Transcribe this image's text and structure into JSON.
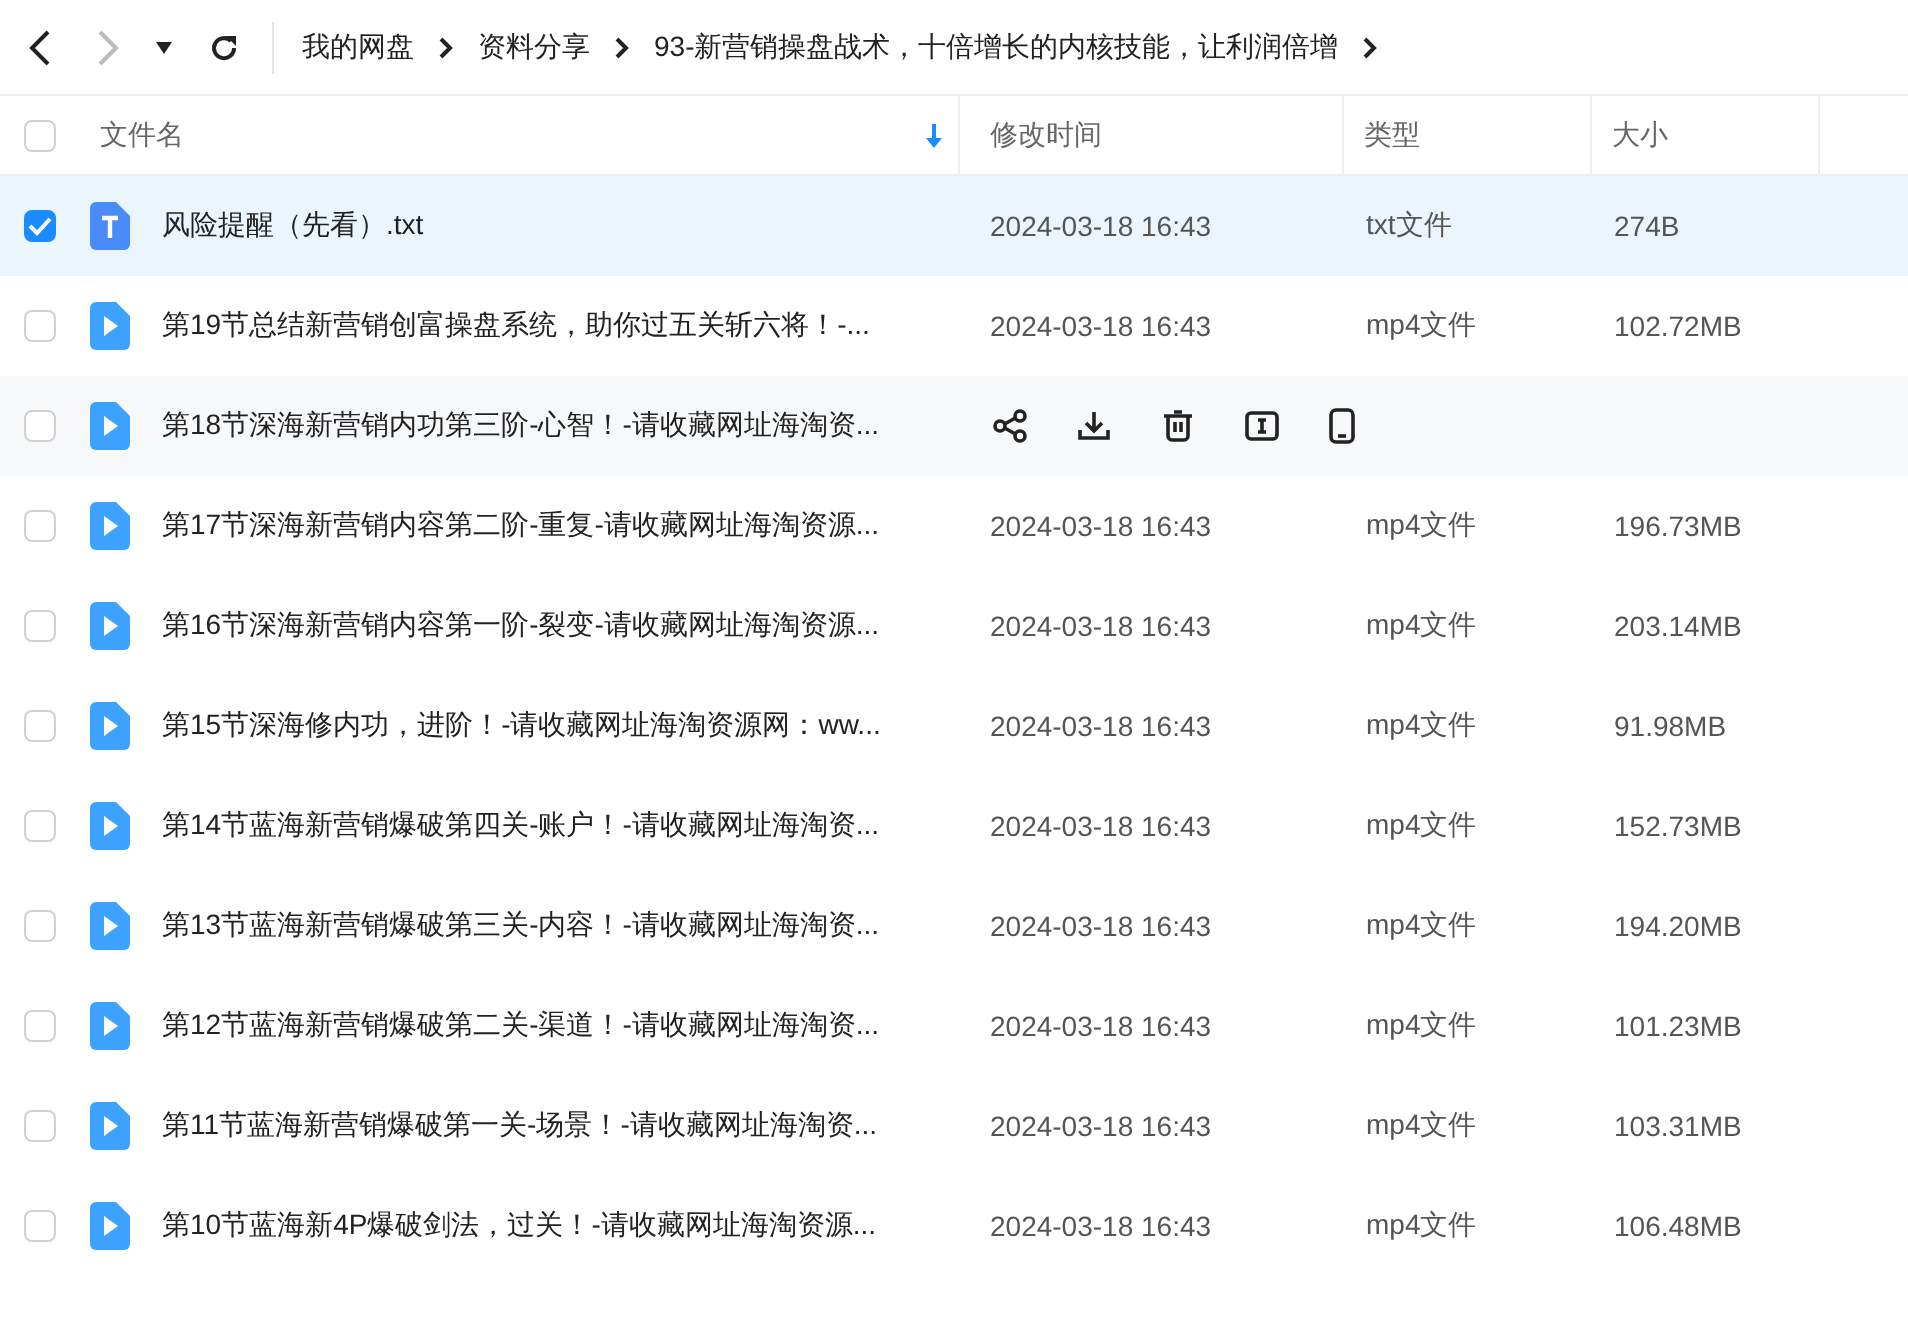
{
  "toolbar": {
    "back_disabled": false,
    "forward_disabled": true
  },
  "breadcrumb": [
    "我的网盘",
    "资料分享",
    "93-新营销操盘战术，十倍增长的内核技能，让利润倍增"
  ],
  "table": {
    "all_checked": false,
    "columns": [
      {
        "label": "文件名",
        "sorted": true
      },
      {
        "label": "修改时间",
        "sorted": false
      },
      {
        "label": "类型",
        "sorted": false
      },
      {
        "label": "大小",
        "sorted": false
      }
    ],
    "rows": [
      {
        "kind": "text",
        "name": "风险提醒（先看）.txt",
        "selected": true,
        "hovered": false,
        "date": "2024-03-18 16:43",
        "type": "txt文件",
        "size": "274B"
      },
      {
        "kind": "video",
        "name": "第19节总结新营销创富操盘系统，助你过五关斩六将！-...",
        "selected": false,
        "hovered": false,
        "date": "2024-03-18 16:43",
        "type": "mp4文件",
        "size": "102.72MB"
      },
      {
        "kind": "video",
        "name": "第18节深海新营销内功第三阶-心智！-请收藏网址海淘资...",
        "selected": false,
        "hovered": true
      },
      {
        "kind": "video",
        "name": "第17节深海新营销内容第二阶-重复-请收藏网址海淘资源...",
        "selected": false,
        "hovered": false,
        "date": "2024-03-18 16:43",
        "type": "mp4文件",
        "size": "196.73MB"
      },
      {
        "kind": "video",
        "name": "第16节深海新营销内容第一阶-裂变-请收藏网址海淘资源...",
        "selected": false,
        "hovered": false,
        "date": "2024-03-18 16:43",
        "type": "mp4文件",
        "size": "203.14MB"
      },
      {
        "kind": "video",
        "name": "第15节深海修内功，进阶！-请收藏网址海淘资源网：ww...",
        "selected": false,
        "hovered": false,
        "date": "2024-03-18 16:43",
        "type": "mp4文件",
        "size": "91.98MB"
      },
      {
        "kind": "video",
        "name": "第14节蓝海新营销爆破第四关-账户！-请收藏网址海淘资...",
        "selected": false,
        "hovered": false,
        "date": "2024-03-18 16:43",
        "type": "mp4文件",
        "size": "152.73MB"
      },
      {
        "kind": "video",
        "name": "第13节蓝海新营销爆破第三关-内容！-请收藏网址海淘资...",
        "selected": false,
        "hovered": false,
        "date": "2024-03-18 16:43",
        "type": "mp4文件",
        "size": "194.20MB"
      },
      {
        "kind": "video",
        "name": "第12节蓝海新营销爆破第二关-渠道！-请收藏网址海淘资...",
        "selected": false,
        "hovered": false,
        "date": "2024-03-18 16:43",
        "type": "mp4文件",
        "size": "101.23MB"
      },
      {
        "kind": "video",
        "name": "第11节蓝海新营销爆破第一关-场景！-请收藏网址海淘资...",
        "selected": false,
        "hovered": false,
        "date": "2024-03-18 16:43",
        "type": "mp4文件",
        "size": "103.31MB"
      },
      {
        "kind": "video",
        "name": "第10节蓝海新4P爆破剑法，过关！-请收藏网址海淘资源...",
        "selected": false,
        "hovered": false,
        "date": "2024-03-18 16:43",
        "type": "mp4文件",
        "size": "106.48MB"
      }
    ]
  }
}
